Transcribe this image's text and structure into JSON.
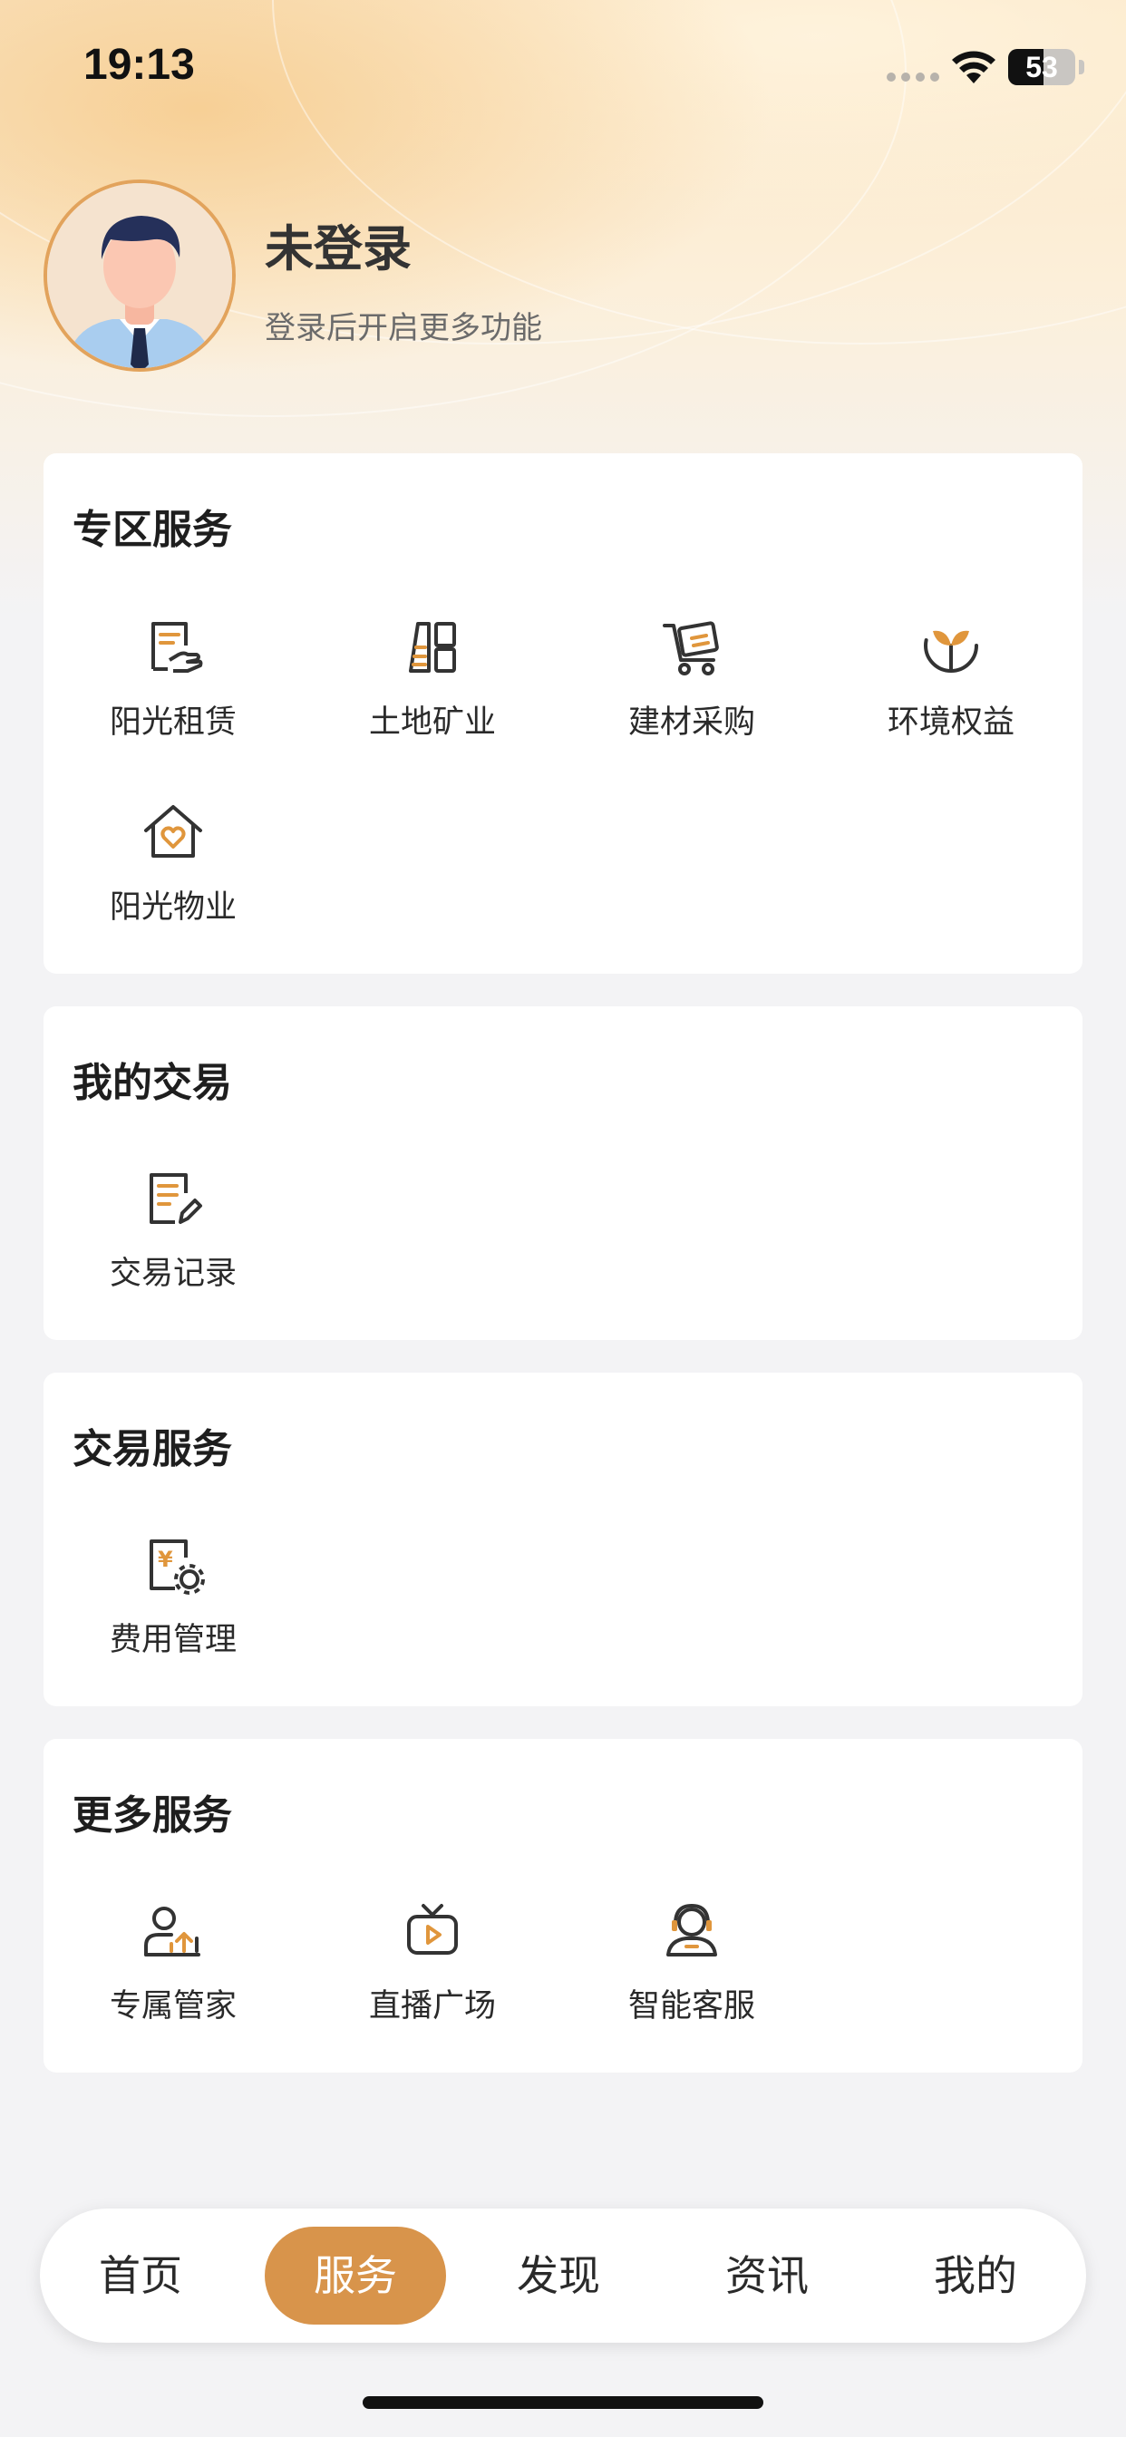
{
  "status_bar": {
    "time": "19:13",
    "battery": "53",
    "battery_level": 0.53
  },
  "profile": {
    "name": "未登录",
    "subtitle": "登录后开启更多功能"
  },
  "sections": [
    {
      "title": "专区服务",
      "items": [
        {
          "label": "阳光租赁",
          "icon": "lease-document-icon"
        },
        {
          "label": "土地矿业",
          "icon": "land-mining-icon"
        },
        {
          "label": "建材采购",
          "icon": "cart-icon"
        },
        {
          "label": "环境权益",
          "icon": "sprout-icon"
        },
        {
          "label": "阳光物业",
          "icon": "house-heart-icon"
        }
      ]
    },
    {
      "title": "我的交易",
      "items": [
        {
          "label": "交易记录",
          "icon": "record-edit-icon"
        }
      ]
    },
    {
      "title": "交易服务",
      "items": [
        {
          "label": "费用管理",
          "icon": "fee-settings-icon"
        }
      ]
    },
    {
      "title": "更多服务",
      "items": [
        {
          "label": "专属管家",
          "icon": "butler-icon"
        },
        {
          "label": "直播广场",
          "icon": "live-tv-icon"
        },
        {
          "label": "智能客服",
          "icon": "headset-agent-icon"
        }
      ]
    }
  ],
  "tabbar": {
    "tabs": [
      "首页",
      "服务",
      "发现",
      "资讯",
      "我的"
    ],
    "active_index": 1
  },
  "colors": {
    "accent": "#d8944b",
    "icon_dark": "#333333",
    "icon_accent": "#e0963c"
  }
}
